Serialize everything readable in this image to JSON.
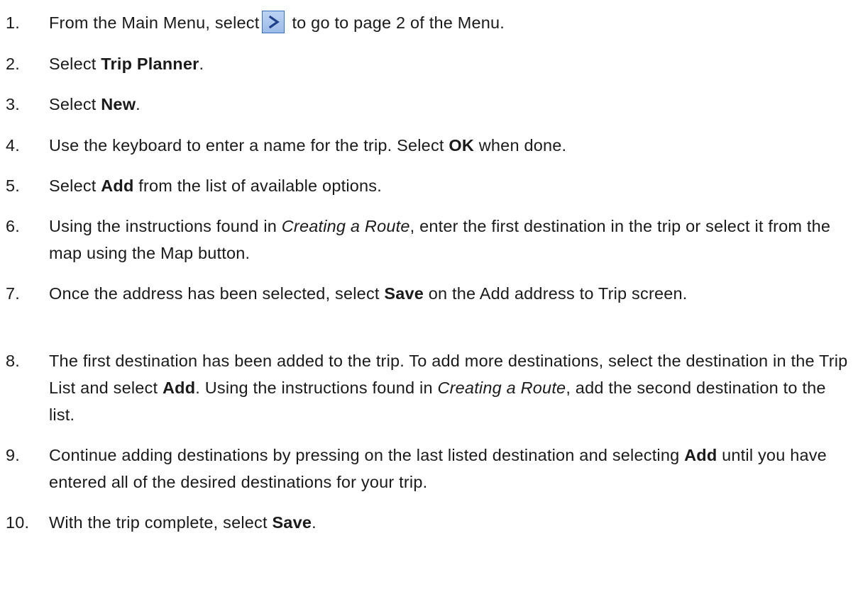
{
  "steps": [
    {
      "number": "1.",
      "pre": "From the Main Menu, select",
      "icon": "next-page-arrow-icon",
      "post": "to go to page 2 of the Menu."
    },
    {
      "number": "2.",
      "pre": "Select ",
      "bold": "Trip Planner",
      "post": "."
    },
    {
      "number": "3.",
      "pre": "Select ",
      "bold": "New",
      "post": "."
    },
    {
      "number": "4.",
      "pre": "Use the keyboard to enter a name for the trip. Select ",
      "bold": "OK",
      "post": " when done."
    },
    {
      "number": "5.",
      "pre": "Select ",
      "bold": "Add",
      "post": " from the list of available options."
    },
    {
      "number": "6.",
      "pre": "Using the instructions found in ",
      "italic": "Creating a Route",
      "post": ", enter the first destination in the trip or select it from the map using the Map button."
    },
    {
      "number": "7.",
      "pre": "Once the address has been selected, select ",
      "bold": "Save",
      "post": " on the Add address to Trip screen."
    },
    {
      "number": "8.",
      "pre": "The first destination has been added to the trip. To add more destinations, select the destination in the Trip List and select ",
      "bold": "Add",
      "mid": ". Using the instructions found in ",
      "italic": "Creating a Route",
      "post": ", add the second destination to the list."
    },
    {
      "number": "9.",
      "pre": "Continue adding destinations by pressing on the last listed destination and selecting ",
      "bold": "Add",
      "post": " until you have entered all of the desired destinations for your trip."
    },
    {
      "number": "10.",
      "pre": "With the trip complete, select ",
      "bold": "Save",
      "post": "."
    }
  ],
  "colors": {
    "text": "#1a1a1a",
    "button_border": "#3a6fc0",
    "button_fill": "#bcd3f2",
    "arrow": "#1f3f8a"
  }
}
